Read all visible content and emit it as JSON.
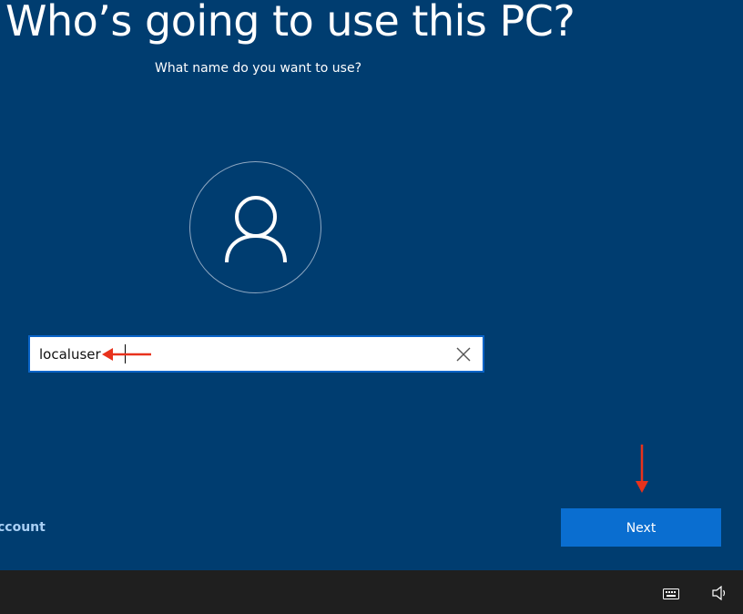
{
  "setup": {
    "title": "Who’s going to use this PC?",
    "subtitle": "What name do you want to use?",
    "avatar_icon": "user-icon",
    "name_input": {
      "value": "localuser",
      "clear_icon": "close-icon"
    },
    "offline_link": "ccount",
    "next_label": "Next"
  },
  "annotations": {
    "color": "#e8321c",
    "arrows": [
      "arrow-left-icon",
      "arrow-down-icon"
    ]
  },
  "taskbar": {
    "tray_icons": [
      "keyboard-icon",
      "volume-icon"
    ]
  },
  "colors": {
    "background": "#003d70",
    "accent": "#0a6ed0",
    "link": "#a9d0f5",
    "taskbar": "#1f1f1f"
  }
}
